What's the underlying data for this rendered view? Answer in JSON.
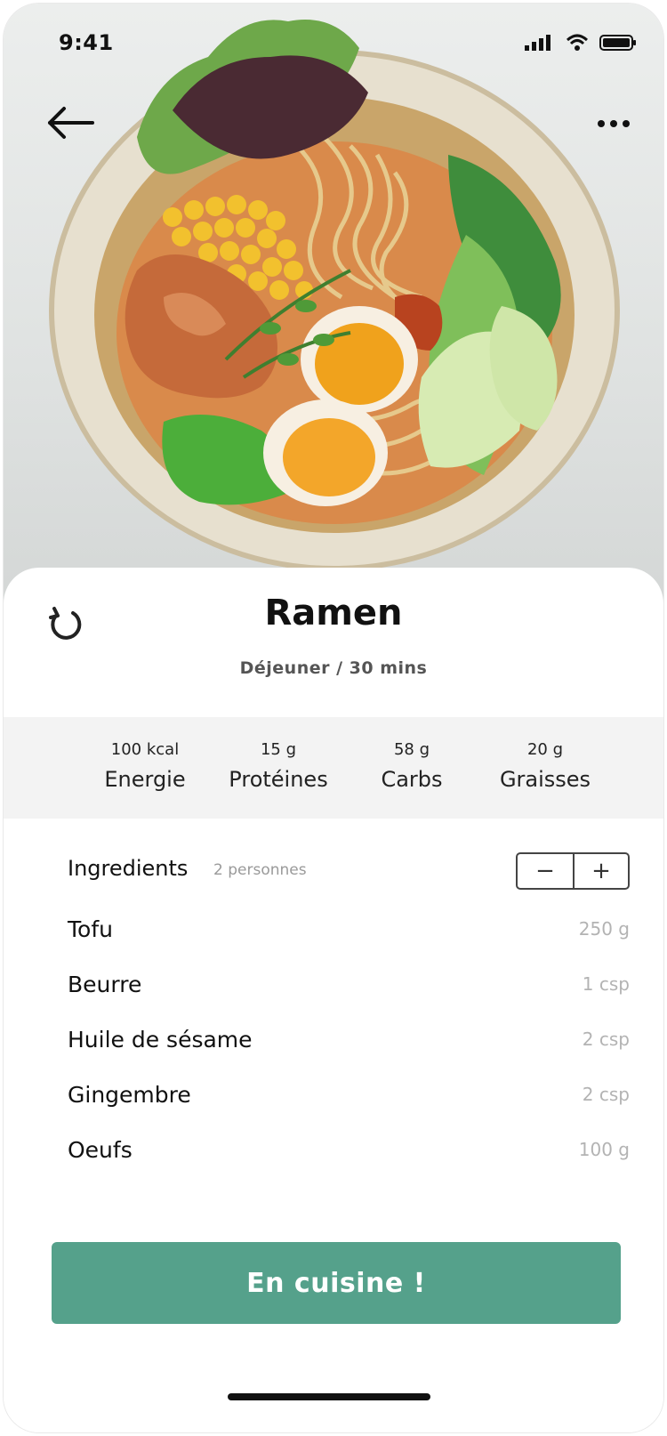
{
  "status_bar": {
    "time": "9:41"
  },
  "nav": {
    "back_icon": "arrow-left-icon",
    "more_icon": "more-horizontal-icon"
  },
  "hero": {
    "image": "ramen-bowl-photo"
  },
  "recipe": {
    "title": "Ramen",
    "subtitle": "Déjeuner / 30 mins",
    "refresh_icon": "refresh-icon"
  },
  "nutrition": [
    {
      "value": "100 kcal",
      "label": "Energie"
    },
    {
      "value": "15 g",
      "label": "Protéines"
    },
    {
      "value": "58 g",
      "label": "Carbs"
    },
    {
      "value": "20 g",
      "label": "Graisses"
    }
  ],
  "ingredients": {
    "title": "Ingredients",
    "servings": "2 personnes",
    "minus_label": "−",
    "plus_label": "+",
    "items": [
      {
        "name": "Tofu",
        "qty": "250 g"
      },
      {
        "name": "Beurre",
        "qty": "1 csp"
      },
      {
        "name": "Huile de sésame",
        "qty": "2 csp"
      },
      {
        "name": "Gingembre",
        "qty": "2 csp"
      },
      {
        "name": "Oeufs",
        "qty": "100 g"
      }
    ]
  },
  "cta": {
    "label": "En cuisine !",
    "color": "#55a18b"
  }
}
